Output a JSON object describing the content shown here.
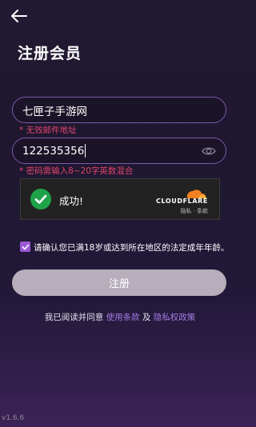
{
  "header": {
    "back_icon": "arrow-left-icon",
    "title": "注册会员"
  },
  "form": {
    "username_value": "七匣子手游网",
    "username_error": "* 无效邮件地址",
    "password_value": "122535356",
    "password_error": "* 密码需输入8~20字英数混合",
    "password_toggle_icon": "eye-icon"
  },
  "captcha": {
    "status_icon": "check-circle-icon",
    "status_text": "成功!",
    "brand": "CLOUDFLARE",
    "privacy_link": "隐私",
    "separator": " · ",
    "terms_link": "条款",
    "accent_color": "#f38020",
    "success_color": "#1fa34a"
  },
  "agreement": {
    "checked": true,
    "text": "请确认您已满18岁或达到所在地区的法定成年年龄。"
  },
  "register_button": {
    "label": "注册"
  },
  "footer": {
    "prefix": "我已阅读并同意 ",
    "terms_link": "使用条款",
    "conjunction": " 及 ",
    "privacy_link": "隐私权政策",
    "version": "v1.6.6"
  },
  "colors": {
    "accent": "#a57ae0",
    "error": "#e0456b",
    "field_border": "#7a5aa8"
  }
}
